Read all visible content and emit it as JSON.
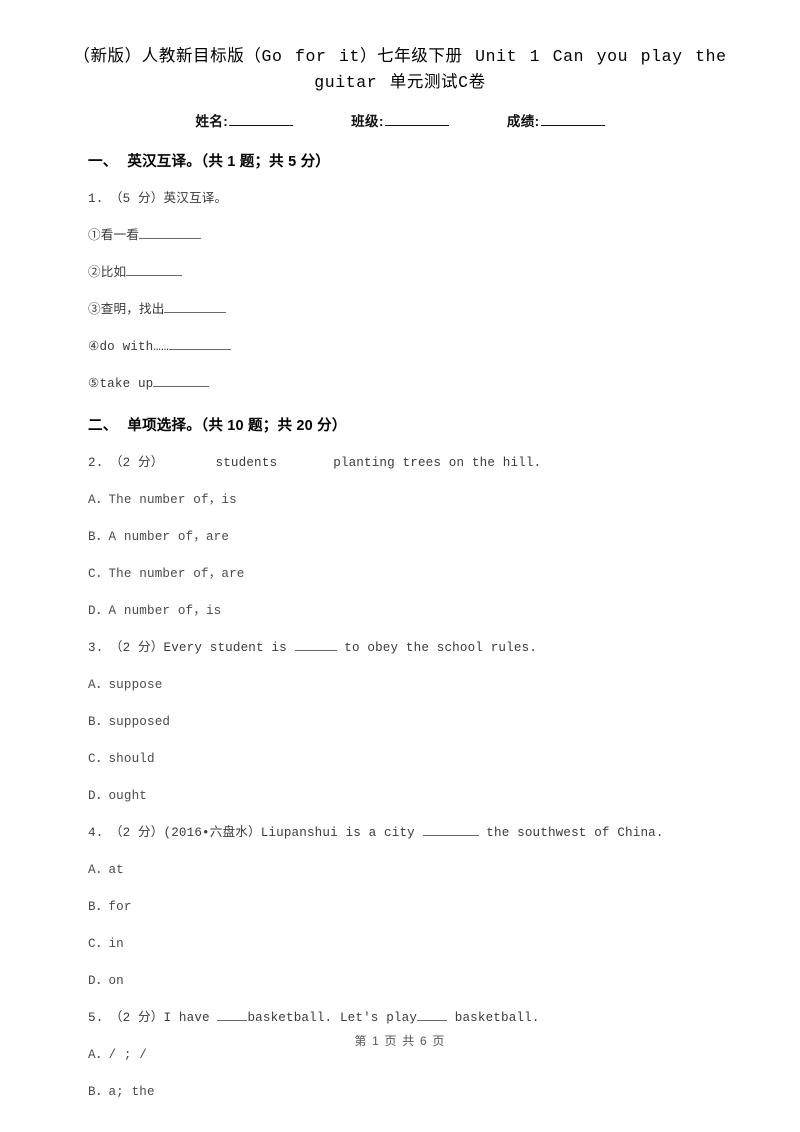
{
  "document": {
    "title": "（新版）人教新目标版（Go for it）七年级下册 Unit 1 Can you play the guitar 单元测试C卷",
    "footer": "第 1 页 共 6 页"
  },
  "meta": {
    "name_label": "姓名:",
    "class_label": "班级:",
    "score_label": "成绩:"
  },
  "sections": [
    {
      "number": "一、",
      "title": "英汉互译。（共 1 题；共 5 分）"
    },
    {
      "number": "二、",
      "title": "单项选择。（共 10 题；共 20 分）"
    }
  ],
  "questions": [
    {
      "stem": "1.　（5 分）英汉互译。",
      "subitems": [
        "①看一看",
        "②比如",
        "③查明，找出",
        "④do with……",
        "⑤take up"
      ]
    },
    {
      "stem_pre": "2.　（2 分）",
      "stem_mid": "students",
      "stem_post": "planting trees on the hill.",
      "options": [
        "A．The number of，is",
        "B．A number of，are",
        "C．The number of，are",
        "D．A number of，is"
      ]
    },
    {
      "stem_pre": "3.　（2 分）Every student is ",
      "stem_post": " to obey the school rules.",
      "options": [
        "A．suppose",
        "B．supposed",
        "C．should",
        "D．ought"
      ]
    },
    {
      "stem_pre": "4.　（2 分）(2016•六盘水）Liupanshui is a city ",
      "stem_post": " the southwest of China.",
      "options": [
        "A．at",
        "B．for",
        "C．in",
        "D．on"
      ]
    },
    {
      "stem_pre": "5.　（2 分）I have ",
      "stem_mid": "basketball. Let's play",
      "stem_post": " basketball.",
      "options": [
        "A．/ ; /",
        "B．a; the"
      ]
    }
  ]
}
